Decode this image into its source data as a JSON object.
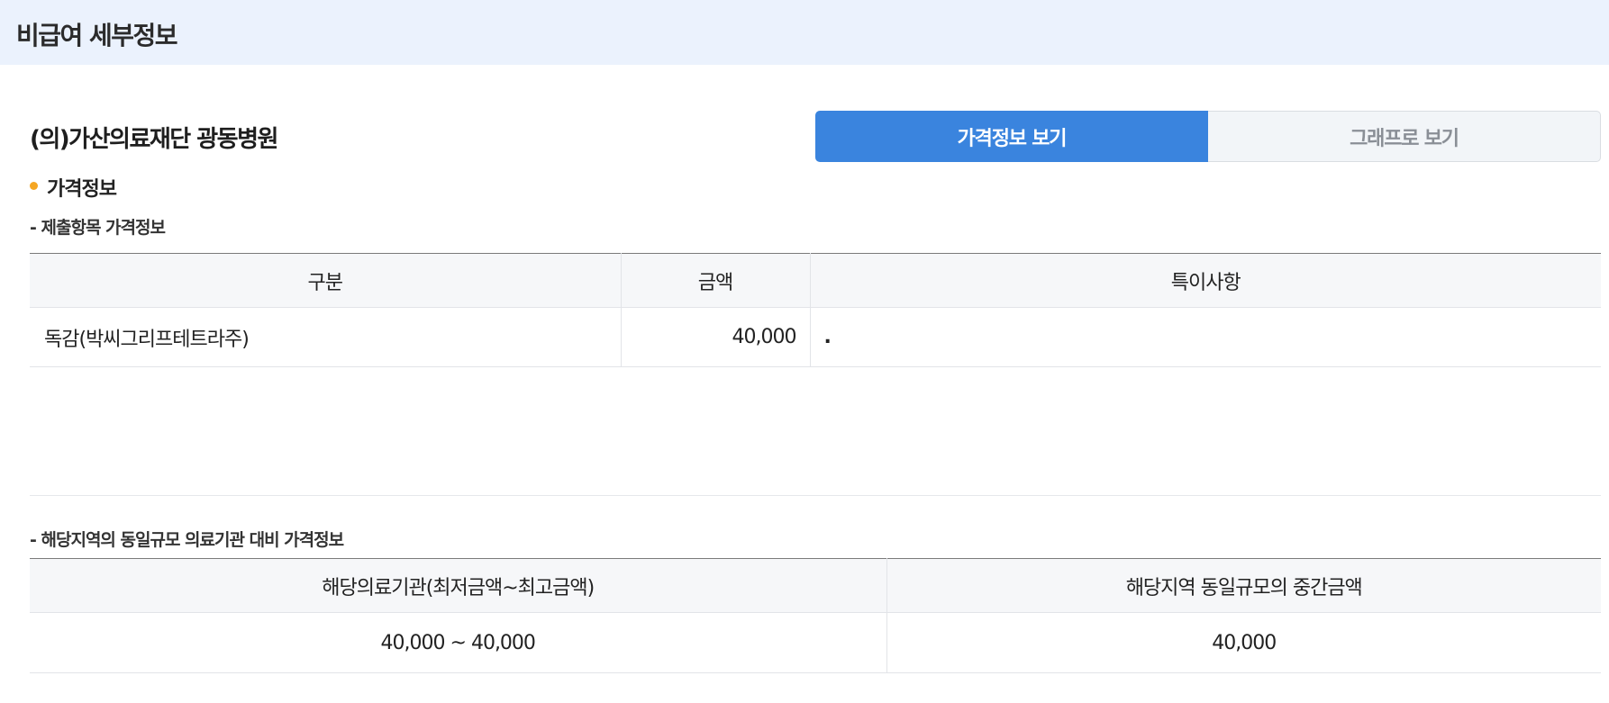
{
  "header": {
    "title": "비급여 세부정보"
  },
  "hospital": {
    "name": "(의)가산의료재단 광동병원"
  },
  "tabs": [
    {
      "label": "가격정보 보기",
      "active": true
    },
    {
      "label": "그래프로 보기",
      "active": false
    }
  ],
  "section": {
    "title": "가격정보"
  },
  "submitted": {
    "label": "- 제출항목 가격정보",
    "columns": [
      "구분",
      "금액",
      "특이사항"
    ],
    "rows": [
      {
        "name": "독감(박씨그리프테트라주)",
        "amount": "40,000",
        "note": "."
      }
    ]
  },
  "comparison": {
    "label": "- 해당지역의 동일규모 의료기관 대비 가격정보",
    "columns": [
      "해당의료기관(최저금액~최고금액)",
      "해당지역 동일규모의 중간금액"
    ],
    "rows": [
      {
        "range": "40,000 ~ 40,000",
        "median": "40,000"
      }
    ]
  },
  "colors": {
    "header_bg": "#ebf2fd",
    "active_tab": "#3a84de",
    "inactive_tab": "#f2f5f8",
    "bullet": "#f5a623"
  }
}
